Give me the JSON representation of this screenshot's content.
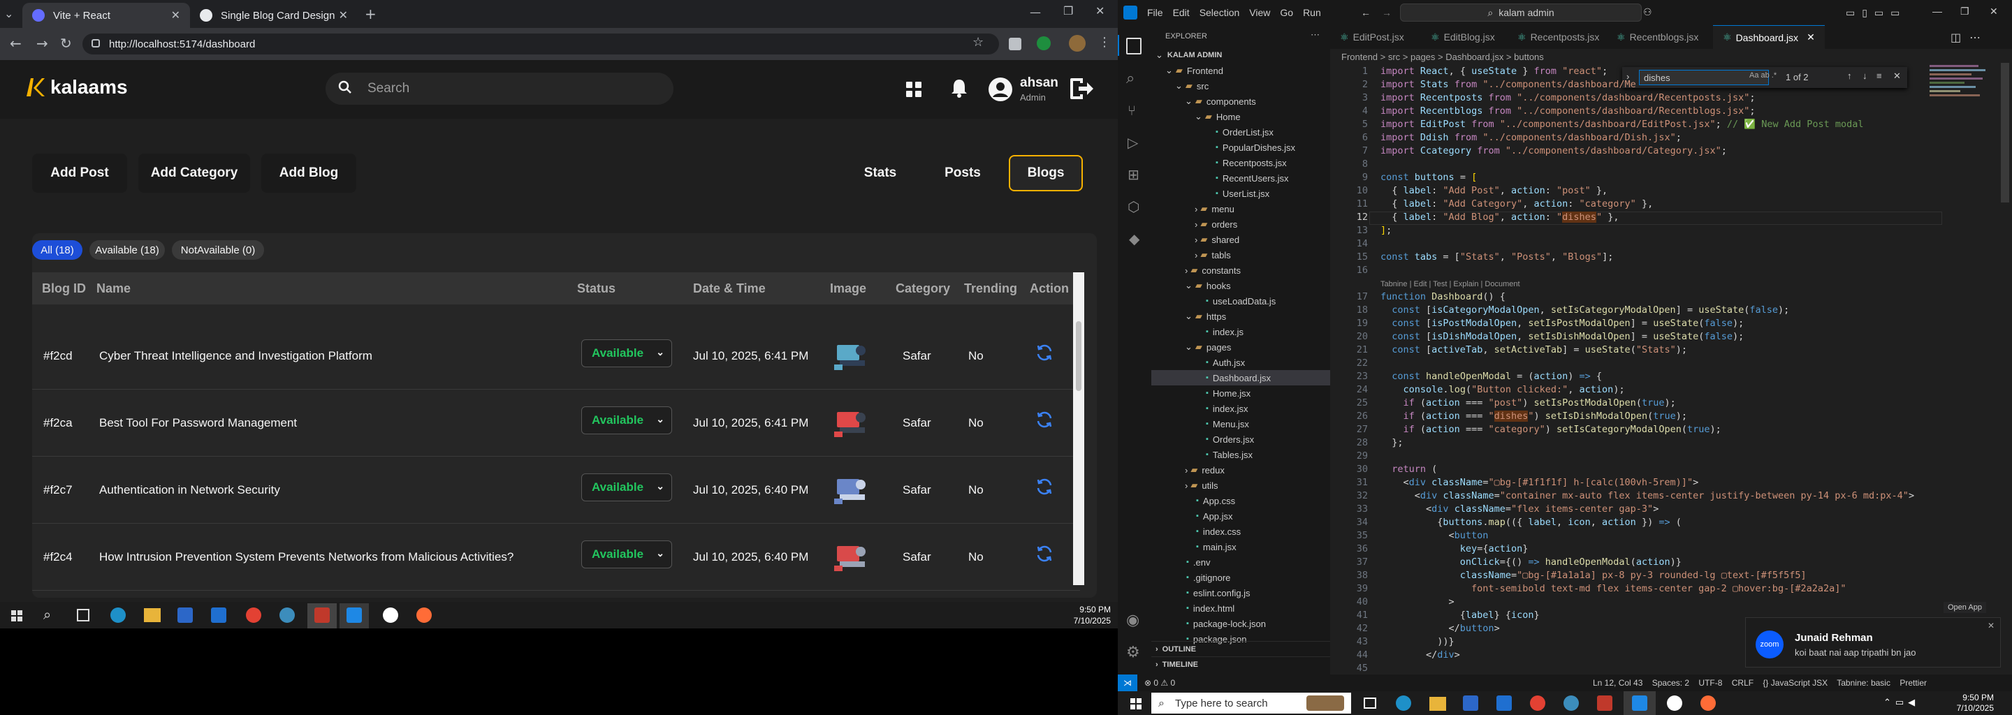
{
  "browser": {
    "tabs": [
      {
        "label": "Vite + React",
        "active": true
      },
      {
        "label": "Single Blog Card Design",
        "active": false
      }
    ],
    "url": "http://localhost:5174/dashboard"
  },
  "app": {
    "logo": "kalaams",
    "search_placeholder": "Search",
    "user": {
      "name": "ahsan",
      "role": "Admin"
    },
    "action_buttons": [
      "Add Post",
      "Add Category",
      "Add Blog"
    ],
    "tabs": [
      "Stats",
      "Posts",
      "Blogs"
    ],
    "selected_tab": "Blogs",
    "filters": [
      "All (18)",
      "Available (18)",
      "NotAvailable (0)"
    ],
    "table": {
      "headers": [
        "Blog ID",
        "Name",
        "Status",
        "Date & Time",
        "Image",
        "Category",
        "Trending",
        "Action"
      ],
      "rows": [
        {
          "id": "#f2cd",
          "name": "Cyber Threat Intelligence and Investigation Platform",
          "status": "Available",
          "date": "Jul 10, 2025, 6:41 PM",
          "category": "Safar",
          "trending": "No"
        },
        {
          "id": "#f2ca",
          "name": "Best Tool For Password Management",
          "status": "Available",
          "date": "Jul 10, 2025, 6:41 PM",
          "category": "Safar",
          "trending": "No"
        },
        {
          "id": "#f2c7",
          "name": "Authentication in Network Security",
          "status": "Available",
          "date": "Jul 10, 2025, 6:40 PM",
          "category": "Safar",
          "trending": "No"
        },
        {
          "id": "#f2c4",
          "name": "How Intrusion Prevention System Prevents Networks from Malicious Activities?",
          "status": "Available",
          "date": "Jul 10, 2025, 6:40 PM",
          "category": "Safar",
          "trending": "No"
        }
      ]
    }
  },
  "taskbar_left": {
    "time": "9:50 PM",
    "date": "7/10/2025"
  },
  "vscode": {
    "menu": [
      "File",
      "Edit",
      "Selection",
      "View",
      "Go",
      "Run"
    ],
    "search": "kalam admin",
    "explorer_title": "EXPLORER",
    "tree": [
      {
        "label": "KALAM ADMIN",
        "depth": 0,
        "kind": "root"
      },
      {
        "label": "Frontend",
        "depth": 1,
        "kind": "folder"
      },
      {
        "label": "src",
        "depth": 2,
        "kind": "folder"
      },
      {
        "label": "components",
        "depth": 3,
        "kind": "folder"
      },
      {
        "label": "Home",
        "depth": 4,
        "kind": "folder"
      },
      {
        "label": "OrderList.jsx",
        "depth": 5,
        "kind": "file"
      },
      {
        "label": "PopularDishes.jsx",
        "depth": 5,
        "kind": "file"
      },
      {
        "label": "Recentposts.jsx",
        "depth": 5,
        "kind": "file"
      },
      {
        "label": "RecentUsers.jsx",
        "depth": 5,
        "kind": "file"
      },
      {
        "label": "UserList.jsx",
        "depth": 5,
        "kind": "file"
      },
      {
        "label": "menu",
        "depth": 4,
        "kind": "cfolder"
      },
      {
        "label": "orders",
        "depth": 4,
        "kind": "cfolder"
      },
      {
        "label": "shared",
        "depth": 4,
        "kind": "cfolder"
      },
      {
        "label": "tabls",
        "depth": 4,
        "kind": "cfolder"
      },
      {
        "label": "constants",
        "depth": 3,
        "kind": "cfolder"
      },
      {
        "label": "hooks",
        "depth": 3,
        "kind": "folder"
      },
      {
        "label": "useLoadData.js",
        "depth": 4,
        "kind": "file"
      },
      {
        "label": "https",
        "depth": 3,
        "kind": "folder"
      },
      {
        "label": "index.js",
        "depth": 4,
        "kind": "file"
      },
      {
        "label": "pages",
        "depth": 3,
        "kind": "folder"
      },
      {
        "label": "Auth.jsx",
        "depth": 4,
        "kind": "file"
      },
      {
        "label": "Dashboard.jsx",
        "depth": 4,
        "kind": "file",
        "selected": true
      },
      {
        "label": "Home.jsx",
        "depth": 4,
        "kind": "file"
      },
      {
        "label": "index.jsx",
        "depth": 4,
        "kind": "file"
      },
      {
        "label": "Menu.jsx",
        "depth": 4,
        "kind": "file"
      },
      {
        "label": "Orders.jsx",
        "depth": 4,
        "kind": "file"
      },
      {
        "label": "Tables.jsx",
        "depth": 4,
        "kind": "file"
      },
      {
        "label": "redux",
        "depth": 3,
        "kind": "cfolder"
      },
      {
        "label": "utils",
        "depth": 3,
        "kind": "cfolder"
      },
      {
        "label": "App.css",
        "depth": 3,
        "kind": "file"
      },
      {
        "label": "App.jsx",
        "depth": 3,
        "kind": "file"
      },
      {
        "label": "index.css",
        "depth": 3,
        "kind": "file"
      },
      {
        "label": "main.jsx",
        "depth": 3,
        "kind": "file"
      },
      {
        "label": ".env",
        "depth": 2,
        "kind": "file"
      },
      {
        "label": ".gitignore",
        "depth": 2,
        "kind": "file"
      },
      {
        "label": "eslint.config.js",
        "depth": 2,
        "kind": "file"
      },
      {
        "label": "index.html",
        "depth": 2,
        "kind": "file"
      },
      {
        "label": "package-lock.json",
        "depth": 2,
        "kind": "file"
      },
      {
        "label": "package.json",
        "depth": 2,
        "kind": "file"
      }
    ],
    "outline": "OUTLINE",
    "timeline": "TIMELINE",
    "tabs": [
      "EditPost.jsx",
      "EditBlog.jsx",
      "Recentposts.jsx",
      "Recentblogs.jsx",
      "Dashboard.jsx"
    ],
    "active_tab": "Dashboard.jsx",
    "breadcrumb": "Frontend > src > pages > Dashboard.jsx > buttons",
    "find": {
      "query": "dishes",
      "count": "1 of 2"
    },
    "codelens": "Tabnine | Edit | Test | Explain | Document",
    "status_right": "Ln 12, Col 43    Spaces: 2    UTF-8    CRLF    {} JavaScript JSX    Tabnine: basic    Prettier",
    "notification": {
      "name": "Junaid Rehman",
      "message": "koi baat nai aap tripathi bn jao",
      "app": "zoom"
    },
    "open_app": "Open App"
  },
  "taskbar_right": {
    "search": "Type here to search",
    "time": "9:50 PM",
    "date": "7/10/2025"
  },
  "colors": {
    "accent": "#f6b100",
    "available": "#22c55e",
    "pill_active": "#1d4ed8",
    "vscode_blue": "#0078d4"
  }
}
